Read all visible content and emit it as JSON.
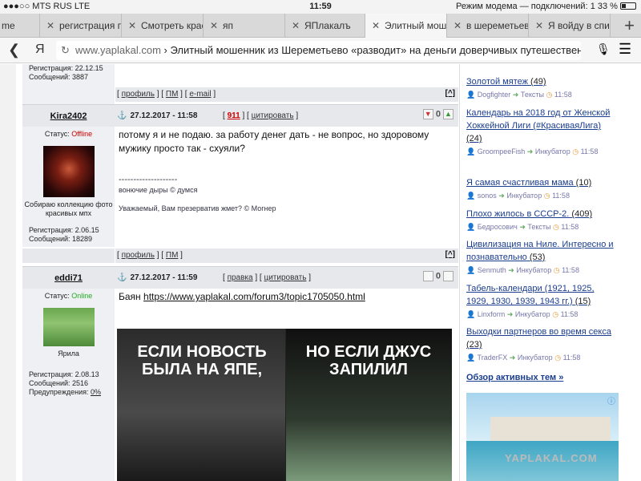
{
  "statusbar": {
    "carrier": "●●●○○ MTS RUS  LTE",
    "time": "11:59",
    "right": "Режим модема — подключений: 1  33 %"
  },
  "tabs": [
    {
      "label": "me"
    },
    {
      "label": "регистрация п"
    },
    {
      "label": "Смотреть крас"
    },
    {
      "label": "яп"
    },
    {
      "label": "ЯПлакалъ"
    },
    {
      "label": "Элитный мош"
    },
    {
      "label": "в шереметьево"
    },
    {
      "label": "Я войду в спис"
    }
  ],
  "urlbar": {
    "ya": "Я",
    "domain": "www.yaplakal.com",
    "sep": " › ",
    "title": "Элитный мошенник из Шереметьево «разводит» на деньги доверчивых путешествен"
  },
  "prev_post": {
    "reg": "Регистрация: 22.12.15",
    "msgs": "Сообщений: 3887",
    "links": [
      "профиль",
      "ПМ",
      "e-mail"
    ],
    "top": "[^]"
  },
  "post1": {
    "username": "Kira2402",
    "date": "27.12.2017 - 11:58",
    "number": "911",
    "quote": "цитировать",
    "rating": "0",
    "status_label": "Статус:",
    "status": "Offline",
    "caption": "Собираю коллекцию фото красивых мпх",
    "reg": "Регистрация: 2.06.15",
    "msgs": "Сообщений: 18289",
    "text": "потому я и не подаю. за работу денег дать - не вопрос, но здоровому мужику просто так - схуяли?",
    "sig_line": "--------------------",
    "sig1": "вонючие дыры © думся",
    "sig2": "Уважаемый, Вам презерватив жмет? © Могнер",
    "links": [
      "профиль",
      "ПМ"
    ],
    "top": "[^]"
  },
  "post2": {
    "username": "eddi71",
    "date": "27.12.2017 - 11:59",
    "edit": "правка",
    "quote": "цитировать",
    "rating": "0",
    "status_label": "Статус:",
    "status": "Online",
    "caption": "Ярила",
    "reg": "Регистрация: 2.08.13",
    "msgs": "Сообщений: 2516",
    "warn": "Предупреждения:",
    "warn_val": "0%",
    "text_prefix": "Баян ",
    "link": "https://www.yaplakal.com/forum3/topic1705050.html",
    "meme_left": "ЕСЛИ НОВОСТЬ БЫЛА НА ЯПЕ,",
    "meme_right": "НО ЕСЛИ ДЖУС ЗАПИЛИЛ"
  },
  "sidebar": {
    "items": [
      {
        "title": "Золотой мятеж",
        "count": "(49)",
        "user": "Dogfighter",
        "section": "Тексты",
        "time": "11:58"
      },
      {
        "title": "Календарь на 2018 год от Женской Хоккейной Лиги (#КрасиваяЛига)",
        "count": "(24)",
        "user": "GroompeeFish",
        "section": "Инкубатор",
        "time": "11:58"
      },
      {
        "title": "Я самая счастливая мама",
        "count": "(10)",
        "user": "sonos",
        "section": "Инкубатор",
        "time": "11:58"
      },
      {
        "title": "Плохо жилось в СССР-2.",
        "count": "(409)",
        "user": "Бедросович",
        "section": "Тексты",
        "time": "11:58"
      },
      {
        "title": "Цивилизация на Ниле. Интересно и познавательно",
        "count": "(53)",
        "user": "Senmuth",
        "section": "Инкубатор",
        "time": "11:58"
      },
      {
        "title": "Табель-календари (1921, 1925, 1929, 1930, 1939, 1943 гг.)",
        "count": "(15)",
        "user": "Linxform",
        "section": "Инкубатор",
        "time": "11:58"
      },
      {
        "title": "Выходки партнеров во время секса",
        "count": "(23)",
        "user": "TraderFX",
        "section": "Инкубатор",
        "time": "11:58"
      }
    ],
    "obzor": "Обзор активных тем »",
    "watermark": "YAPLAKAL.COM"
  }
}
